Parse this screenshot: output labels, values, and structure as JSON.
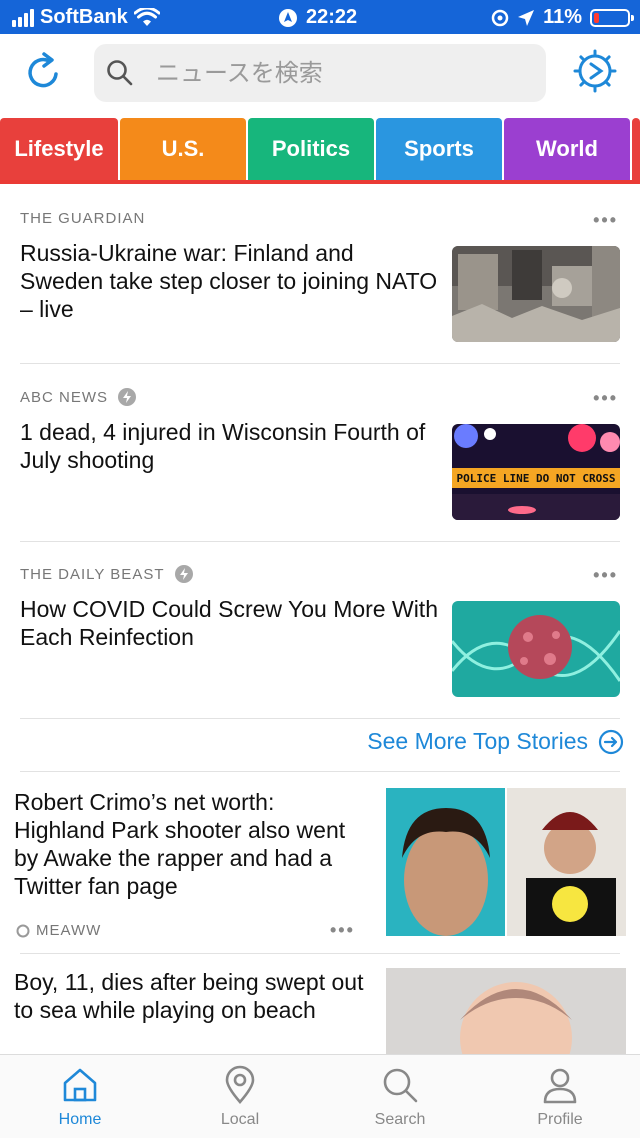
{
  "status_bar": {
    "carrier": "SoftBank",
    "time": "22:22",
    "battery": "11%"
  },
  "search": {
    "placeholder": "ニュースを検索"
  },
  "categories": [
    {
      "label": "Lifestyle",
      "color": "#e8403c"
    },
    {
      "label": "U.S.",
      "color": "#f48a1a"
    },
    {
      "label": "Politics",
      "color": "#17b67c"
    },
    {
      "label": "Sports",
      "color": "#2a96e0"
    },
    {
      "label": "World",
      "color": "#9b3fd0"
    }
  ],
  "top_stories": [
    {
      "source": "THE GUARDIAN",
      "headline": "Russia-Ukraine war: Finland and Sweden take step closer to joining NATO – live",
      "more": "•••"
    },
    {
      "source": "ABC NEWS",
      "headline": "1 dead, 4 injured in Wisconsin Fourth of July shooting",
      "more": "•••",
      "thumb_text": "POLICE LINE DO NOT CROSS"
    },
    {
      "source": "THE DAILY BEAST",
      "headline": "How COVID Could Screw You More With Each Reinfection",
      "more": "•••"
    }
  ],
  "see_more": "See More Top Stories",
  "feed": [
    {
      "headline": "Robert Crimo’s net worth: Highland Park shooter also went by Awake the rapper and had a Twitter fan page",
      "source": "MEAWW",
      "more": "•••"
    },
    {
      "headline": "Boy, 11, dies after being swept out to sea while playing on beach"
    }
  ],
  "tab_bar": [
    {
      "label": "Home",
      "icon": "home-icon",
      "active": true
    },
    {
      "label": "Local",
      "icon": "location-pin-icon"
    },
    {
      "label": "Search",
      "icon": "search-icon"
    },
    {
      "label": "Profile",
      "icon": "person-icon"
    }
  ],
  "colors": {
    "status_bar": "#1565d8",
    "accent": "#1e88d8"
  }
}
